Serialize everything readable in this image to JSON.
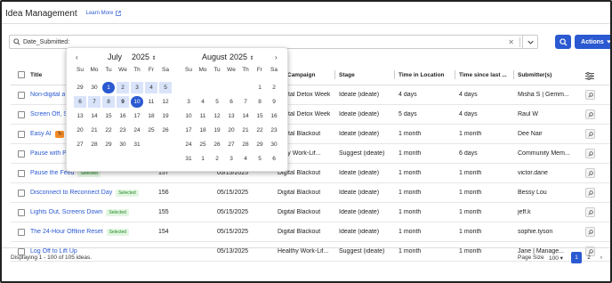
{
  "header": {
    "title": "Idea Management",
    "learn_more": "Learn More"
  },
  "search": {
    "value": "Date_Submitted:",
    "clear_icon": "x-icon",
    "actions_label": "Actions"
  },
  "table": {
    "columns": [
      "Title",
      "Campaign",
      "Stage",
      "Time in Location",
      "Time since last ...",
      "Submitter(s)"
    ],
    "rows": [
      {
        "title": "Non-digital a",
        "badge": "",
        "votes": "",
        "date": "",
        "campaign": "Digital Detox Week",
        "stage": "Ideate (ideate)",
        "tloc": "4 days",
        "tlast": "4 days",
        "submitter": "Misha S | Gemm..."
      },
      {
        "title": "Screen Off, S",
        "badge": "",
        "votes": "",
        "date": "",
        "campaign": "Digital Detox Week",
        "stage": "Ideate (ideate)",
        "tloc": "5 days",
        "tlast": "4 days",
        "submitter": "Raul W"
      },
      {
        "title": "Easy AI",
        "badge": "Tr",
        "votes": "",
        "date": "",
        "campaign": "Digital Blackout",
        "stage": "Ideate (ideate)",
        "tloc": "1 month",
        "tlast": "1 month",
        "submitter": "Dee Nair"
      },
      {
        "title": "Pause with P",
        "badge": "",
        "votes": "",
        "date": "",
        "campaign": "althy Work-Lif...",
        "stage": "Suggest (ideate)",
        "tloc": "1 month",
        "tlast": "6 days",
        "submitter": "Community Mem..."
      },
      {
        "title": "Pause the Feed",
        "badge": "Selected",
        "votes": "157",
        "date": "05/15/2025",
        "campaign": "Digital Blackout",
        "stage": "Ideate (ideate)",
        "tloc": "1 month",
        "tlast": "1 month",
        "submitter": "victor.dane"
      },
      {
        "title": "Disconnect to Reconnect Day",
        "badge": "Selected",
        "votes": "156",
        "date": "05/15/2025",
        "campaign": "Digital Blackout",
        "stage": "Ideate (ideate)",
        "tloc": "1 month",
        "tlast": "1 month",
        "submitter": "Bessy Lou"
      },
      {
        "title": "Lights Out, Screens Down",
        "badge": "Selected",
        "votes": "155",
        "date": "05/15/2025",
        "campaign": "Digital Blackout",
        "stage": "Ideate (ideate)",
        "tloc": "1 month",
        "tlast": "1 month",
        "submitter": "jeff.k"
      },
      {
        "title": "The 24-Hour Offline Reset",
        "badge": "Selected",
        "votes": "154",
        "date": "05/15/2025",
        "campaign": "Digital Blackout",
        "stage": "Ideate (ideate)",
        "tloc": "1 month",
        "tlast": "1 month",
        "submitter": "sophie.tyson"
      },
      {
        "title": "Log Off to Lift Up",
        "badge": "",
        "votes": "",
        "date": "05/13/2025",
        "campaign": "Healthy Work-Lif...",
        "stage": "Suggest (ideate)",
        "tloc": "1 month",
        "tlast": "1 month",
        "submitter": "Jane | Manage..."
      }
    ]
  },
  "footer": {
    "displaying": "Displaying 1 - 100 of 105 ideas.",
    "page_size_label": "Page Size",
    "page_size_value": "100",
    "pages": [
      "1",
      "2"
    ]
  },
  "calendar": {
    "weekdays": [
      "Su",
      "Mo",
      "Tu",
      "We",
      "Th",
      "Fr",
      "Sa"
    ],
    "left": {
      "month": "July",
      "year": "2025",
      "days": [
        [
          "29",
          "30",
          "1",
          "2",
          "3",
          "4",
          "5"
        ],
        [
          "6",
          "7",
          "8",
          "9",
          "10",
          "11",
          "12"
        ],
        [
          "13",
          "14",
          "15",
          "16",
          "17",
          "18",
          "19"
        ],
        [
          "20",
          "21",
          "22",
          "23",
          "24",
          "25",
          "26"
        ],
        [
          "27",
          "28",
          "29",
          "30",
          "31",
          "",
          ""
        ]
      ]
    },
    "right": {
      "month": "August",
      "year": "2025",
      "days": [
        [
          "",
          "",
          "",
          "",
          "",
          "1",
          "2"
        ],
        [
          "3",
          "4",
          "5",
          "6",
          "7",
          "8",
          "9"
        ],
        [
          "10",
          "11",
          "12",
          "13",
          "14",
          "15",
          "16"
        ],
        [
          "17",
          "18",
          "19",
          "20",
          "21",
          "22",
          "23"
        ],
        [
          "24",
          "25",
          "26",
          "27",
          "28",
          "29",
          "30"
        ],
        [
          "31",
          "1",
          "2",
          "3",
          "4",
          "5",
          "6"
        ]
      ]
    }
  },
  "colors": {
    "primary": "#2a59d1",
    "range": "#d9e4fa",
    "selected_badge": "#e3f6e3",
    "trending_badge": "#f28b25"
  }
}
